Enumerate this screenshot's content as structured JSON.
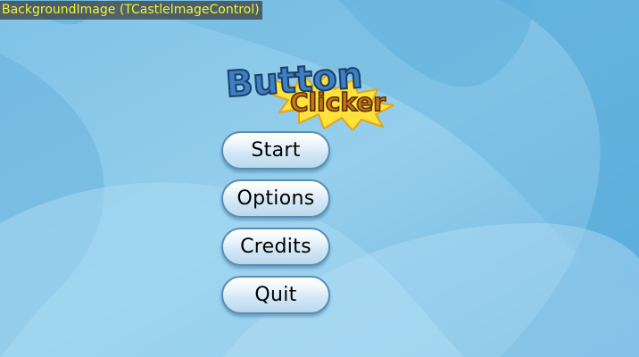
{
  "debug_label": "BackgroundImage (TCastleImageControl)",
  "logo": {
    "line1": "Button",
    "line2": "Clicker"
  },
  "menu": {
    "items": [
      {
        "id": "start",
        "label": "Start"
      },
      {
        "id": "options",
        "label": "Options"
      },
      {
        "id": "credits",
        "label": "Credits"
      },
      {
        "id": "quit",
        "label": "Quit"
      }
    ]
  },
  "colors": {
    "background": "#8cc9e8",
    "label_text": "#f2f233",
    "logo_blue": "#3b7fc4",
    "logo_star": "#ffe23a",
    "logo_orange": "#c7741c"
  }
}
